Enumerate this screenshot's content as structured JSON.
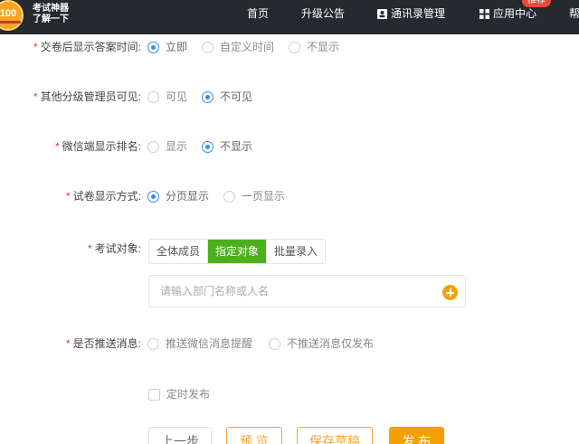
{
  "header": {
    "logo_number": "100",
    "logo_line1": "考试神器",
    "logo_line2": "了解一下",
    "nav": {
      "home": "首页",
      "announcements": "升级公告",
      "contacts": "通讯录管理",
      "app_center": "应用中心",
      "app_center_badge": "推荐",
      "help": "帮"
    }
  },
  "form": {
    "show_answer_time": {
      "label": "交卷后显示答案时间:",
      "options": [
        "立即",
        "自定义时间",
        "不显示"
      ],
      "selected": "立即"
    },
    "other_admin_visible": {
      "label": "其他分级管理员可见:",
      "options": [
        "可见",
        "不可见"
      ],
      "selected": "不可见"
    },
    "wechat_ranking": {
      "label": "微信端显示排名:",
      "options": [
        "显示",
        "不显示"
      ],
      "selected": "不显示"
    },
    "paper_display": {
      "label": "试卷显示方式:",
      "options": [
        "分页显示",
        "一页显示"
      ],
      "selected": "分页显示"
    },
    "exam_target": {
      "label": "考试对象:",
      "tabs": [
        "全体成员",
        "指定对象",
        "批量录入"
      ],
      "active_tab": "指定对象",
      "search_placeholder": "请输入部门名称或人名",
      "search_value": ""
    },
    "push_message": {
      "label": "是否推送消息:",
      "options": [
        "推送微信消息提醒",
        "不推送消息仅发布"
      ],
      "selected": ""
    },
    "scheduled_publish": {
      "label": "定时发布",
      "checked": false
    }
  },
  "actions": {
    "prev": "上一步",
    "preview": "预 览",
    "save_draft": "保存草稿",
    "publish": "发 布"
  },
  "colors": {
    "nav_bg": "#26292e",
    "accent_blue": "#2f8ff0",
    "tab_active_green": "#4caf1d",
    "orange": "#f5a000",
    "required_red": "#e53935"
  }
}
